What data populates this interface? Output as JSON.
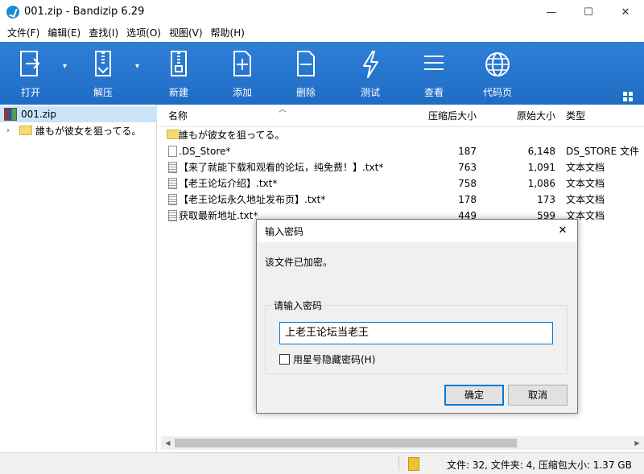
{
  "window": {
    "title": "001.zip - Bandizip 6.29",
    "min": "—",
    "max": "☐",
    "close": "✕"
  },
  "menu": [
    "文件(F)",
    "编辑(E)",
    "查找(I)",
    "选项(O)",
    "视图(V)",
    "帮助(H)"
  ],
  "toolbar": {
    "open": "打开",
    "extract": "解压",
    "new": "新建",
    "add": "添加",
    "delete": "删除",
    "test": "测试",
    "view": "查看",
    "codepage": "代码页"
  },
  "tree": {
    "root": "001.zip",
    "child": "誰もが彼女を狙ってる。"
  },
  "columns": {
    "name": "名称",
    "compressed": "压缩后大小",
    "original": "原始大小",
    "type": "类型"
  },
  "files": [
    {
      "name": "誰もが彼女を狙ってる。",
      "compressed": "",
      "original": "",
      "type": "",
      "icon": "folder"
    },
    {
      "name": ".DS_Store*",
      "compressed": "187",
      "original": "6,148",
      "type": "DS_STORE 文件",
      "icon": "file"
    },
    {
      "name": "【来了就能下载和观看的论坛，纯免费！】.txt*",
      "compressed": "763",
      "original": "1,091",
      "type": "文本文档",
      "icon": "txt"
    },
    {
      "name": "【老王论坛介绍】.txt*",
      "compressed": "758",
      "original": "1,086",
      "type": "文本文档",
      "icon": "txt"
    },
    {
      "name": "【老王论坛永久地址发布页】.txt*",
      "compressed": "178",
      "original": "173",
      "type": "文本文档",
      "icon": "txt"
    },
    {
      "name": "获取最新地址.txt*",
      "compressed": "449",
      "original": "599",
      "type": "文本文档",
      "icon": "txt"
    }
  ],
  "status": {
    "text": "文件: 32, 文件夹: 4, 压缩包大小: 1.37 GB"
  },
  "dialog": {
    "title": "输入密码",
    "message": "该文件已加密。",
    "group_label": "请输入密码",
    "password": "上老王论坛当老王",
    "hide_label": "用星号隐藏密码(H)",
    "ok": "确定",
    "cancel": "取消",
    "close": "✕"
  },
  "colors": {
    "toolbar": "#2a78d2",
    "selection": "#cce4f7",
    "accent": "#0078d7"
  }
}
